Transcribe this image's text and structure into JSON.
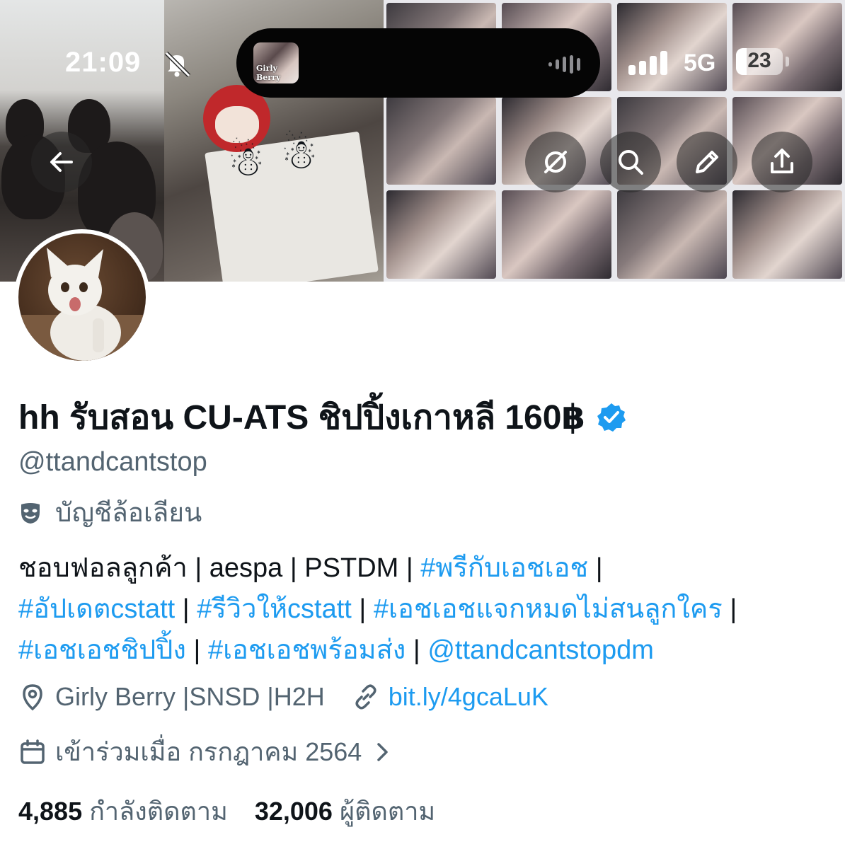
{
  "status_bar": {
    "time": "21:09",
    "network": "5G",
    "battery": "23",
    "battery_level_percent": 23,
    "island_thumb_text": "Girly Berry"
  },
  "banner_buttons": {
    "back_icon": "arrow-left-icon",
    "grok_icon": "grok-icon",
    "search_icon": "search-icon",
    "edit_icon": "pencil-icon",
    "share_icon": "share-icon"
  },
  "profile": {
    "display_name": "hh รับสอน CU-ATS ชิปปิ้งเกาหลี 160฿",
    "verified": true,
    "handle": "@ttandcantstop",
    "parody_label": "บัญชีล้อเลียน",
    "bio": {
      "line1_plain": "ชอบฟอลลูกค้า | aespa | PSTDM | ",
      "line1_tag": "#พรีกับเอชเอช",
      "line1_end": " |",
      "line2_tag1": "#อัปเดตcstatt",
      "sep": " | ",
      "line2_tag2": "#รีวิวให้cstatt",
      "line2_tag3": "#เอชเอชแจกหมดไม่สนลูกใคร",
      "line2_end": " |",
      "line3_tag1": "#เอชเอชชิปปิ้ง",
      "line3_tag2": "#เอชเอชพร้อมส่ง",
      "line3_mention": "@ttandcantstopdm"
    },
    "location": "Girly Berry |SNSD |H2H",
    "website": "bit.ly/4gcaLuK",
    "joined": "เข้าร่วมเมื่อ กรกฎาคม 2564",
    "following_count": "4,885",
    "following_label": "กำลังติดตาม",
    "followers_count": "32,006",
    "followers_label": "ผู้ติดตาม"
  },
  "colors": {
    "link": "#1d9bf0",
    "secondary_text": "#536471",
    "primary_text": "#0f1419"
  }
}
